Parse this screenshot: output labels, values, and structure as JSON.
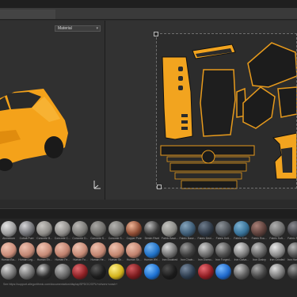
{
  "viewport2d": {
    "uv_set_value": "Material"
  },
  "material_shelf": {
    "rows": [
      [
        {
          "label": "Aluminium",
          "color": "#9a9a9a",
          "hi": "#e6e6e6"
        },
        {
          "label": "Cobalt Pure",
          "color": "#6e6f73",
          "hi": "#d7d7da"
        },
        {
          "label": "Concrete B...",
          "color": "#8c8a86",
          "hi": "#c9c7c3"
        },
        {
          "label": "Concrete C...",
          "color": "#8d8b88",
          "hi": "#cfcdca"
        },
        {
          "label": "Concrete D...",
          "color": "#7a7976",
          "hi": "#bcbab7"
        },
        {
          "label": "Concrete S...",
          "color": "#6d6c69",
          "hi": "#a9a8a5"
        },
        {
          "label": "Concrete S...",
          "color": "#777673",
          "hi": "#b5b4b1"
        },
        {
          "label": "Copper Pure",
          "color": "#8b4a32",
          "hi": "#f0b596"
        },
        {
          "label": "Denim Rivet",
          "color": "#3a3a3a",
          "hi": "#b9b9b9"
        },
        {
          "label": "Fabric Base...",
          "color": "#8a8a86",
          "hi": "#c5c5c1"
        },
        {
          "label": "Fabric Base...",
          "color": "#3c5a73",
          "hi": "#86a5bd"
        },
        {
          "label": "Fabric Deni...",
          "color": "#2e3845",
          "hi": "#6f7d8d"
        },
        {
          "label": "Fabric Knit...",
          "color": "#4a4f55",
          "hi": "#8e949a"
        },
        {
          "label": "Fabric Knit...",
          "color": "#356f95",
          "hi": "#7fb4d4"
        },
        {
          "label": "Fabric Rou...",
          "color": "#5b3f3a",
          "hi": "#a98178"
        },
        {
          "label": "Fabric Soft...",
          "color": "#6b6b6b",
          "hi": "#b0b0b0"
        },
        {
          "label": "Fabric Suit...",
          "color": "#3f3f44",
          "hi": "#8a8a90"
        }
      ],
      [
        {
          "label": "Human Ba...",
          "color": "#c98b78",
          "hi": "#f2c5b3"
        },
        {
          "label": "Human Leg...",
          "color": "#c08673",
          "hi": "#eec0ae"
        },
        {
          "label": "Human Eh...",
          "color": "#c58a76",
          "hi": "#f0c4b2"
        },
        {
          "label": "Human Fe...",
          "color": "#bd7f6c",
          "hi": "#ecbba8"
        },
        {
          "label": "Human Fo...",
          "color": "#c48874",
          "hi": "#f1c6b4"
        },
        {
          "label": "Human He...",
          "color": "#c28571",
          "hi": "#eec0ad"
        },
        {
          "label": "Human Sh...",
          "color": "#c3866f",
          "hi": "#efc3b0"
        },
        {
          "label": "Human Sk...",
          "color": "#c0816d",
          "hi": "#ecbda9"
        },
        {
          "label": "Human Wri...",
          "color": "#1e6fc4",
          "hi": "#79b7f2"
        },
        {
          "label": "Iron Brushed",
          "color": "#6f6f6f",
          "hi": "#d8d8d8"
        },
        {
          "label": "Iron Chain...",
          "color": "#3d3d3d",
          "hi": "#9c9c9c"
        },
        {
          "label": "Iron Diamo...",
          "color": "#6a6a6a",
          "hi": "#cfcfcf"
        },
        {
          "label": "Iron Forged...",
          "color": "#4c4c4c",
          "hi": "#b1b1b1"
        },
        {
          "label": "Iron Galva...",
          "color": "#7c7c7c",
          "hi": "#e2e2e2"
        },
        {
          "label": "Iron Grainy",
          "color": "#5f5f5f",
          "hi": "#c4c4c4"
        },
        {
          "label": "Iron Grinded",
          "color": "#8a8a8a",
          "hi": "#ebebeb"
        },
        {
          "label": "Iron Hamm...",
          "color": "#4f4f4f",
          "hi": "#b8b8b8"
        }
      ],
      [
        {
          "label": "",
          "color": "#707070",
          "hi": "#d9d9d9"
        },
        {
          "label": "",
          "color": "#6c6c6c",
          "hi": "#d2d2d2"
        },
        {
          "label": "",
          "color": "#2a2a2a",
          "hi": "#cfcfcf"
        },
        {
          "label": "",
          "color": "#666",
          "hi": "#bdbdbd"
        },
        {
          "label": "",
          "color": "#8c1f23",
          "hi": "#e06a6f"
        },
        {
          "label": "",
          "color": "#1b1b1b",
          "hi": "#5a5a5a"
        },
        {
          "label": "",
          "color": "#d1b11a",
          "hi": "#fff08a"
        },
        {
          "label": "",
          "color": "#7a1a1d",
          "hi": "#d15a5e"
        },
        {
          "label": "",
          "color": "#1b6fd0",
          "hi": "#7cc0ff"
        },
        {
          "label": "",
          "color": "#1a1a1a",
          "hi": "#4f4f4f"
        },
        {
          "label": "",
          "color": "#2c3b4d",
          "hi": "#7a8ba0"
        },
        {
          "label": "",
          "color": "#8f1c22",
          "hi": "#ea6b72"
        },
        {
          "label": "",
          "color": "#1d67c9",
          "hi": "#76b9ff"
        },
        {
          "label": "",
          "color": "#5b5b5b",
          "hi": "#c9c9c9"
        },
        {
          "label": "",
          "color": "#444",
          "hi": "#a9a9a9"
        },
        {
          "label": "",
          "color": "#777",
          "hi": "#e0e0e0"
        },
        {
          "label": "",
          "color": "#3a3a3a",
          "hi": "#999"
        }
      ]
    ]
  },
  "status_bar": {
    "text": "See https://support.allegorithmic.com/documentation/display/SPDOC/GPU+drivers+crash+"
  },
  "colors": {
    "car_orange": "#f4a21a",
    "uv_orange": "#f2a41f"
  }
}
